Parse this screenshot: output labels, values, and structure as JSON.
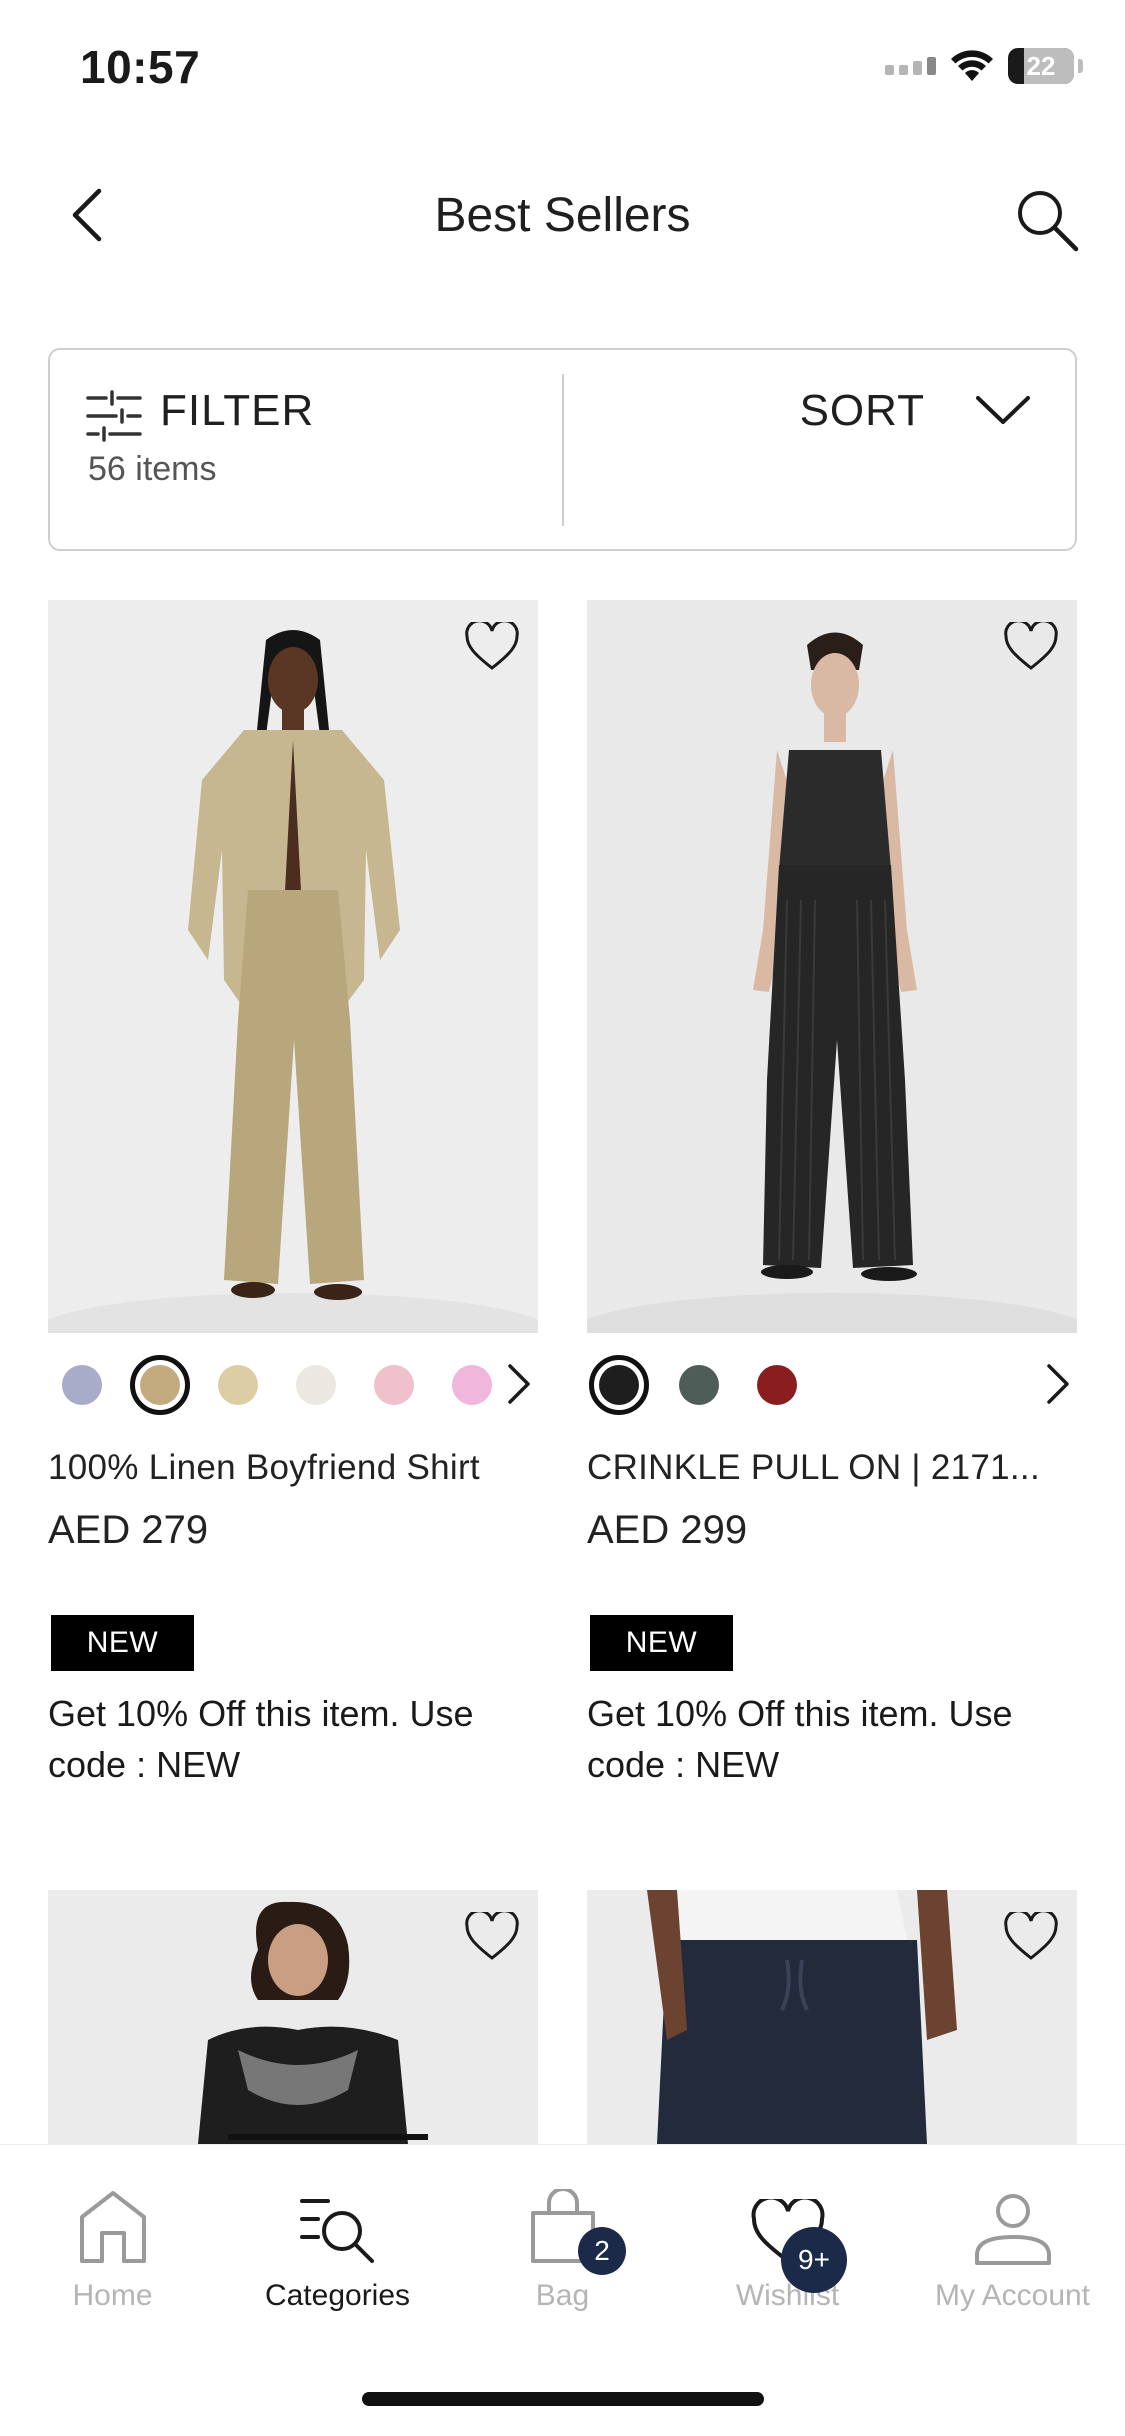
{
  "status_bar": {
    "time": "10:57",
    "battery": "22"
  },
  "header": {
    "title": "Best Sellers"
  },
  "filter_bar": {
    "filter_label": "FILTER",
    "item_count": "56 items",
    "sort_label": "SORT"
  },
  "products": [
    {
      "name": "100% Linen Boyfriend Shirt",
      "price": "AED 279",
      "badge": "NEW",
      "promo": "Get 10% Off this item. Use code : NEW",
      "swatches": [
        "#a8acc8",
        "#c4ab7f",
        "#dccda4",
        "#ebe8e2",
        "#f0c0cc",
        "#f0b6dc"
      ]
    },
    {
      "name": "CRINKLE PULL ON | 2171...",
      "price": "AED 299",
      "badge": "NEW",
      "promo": "Get 10% Off this item. Use code : NEW",
      "swatches": [
        "#1e1e1e",
        "#4f5d58",
        "#8a1e1e"
      ]
    }
  ],
  "tab_bar": {
    "tabs": [
      {
        "label": "Home",
        "icon": "home-icon"
      },
      {
        "label": "Categories",
        "icon": "categories-search-icon"
      },
      {
        "label": "Bag",
        "icon": "bag-icon",
        "badge": "2"
      },
      {
        "label": "Wishlist",
        "icon": "heart-icon",
        "badge": "9+"
      },
      {
        "label": "My Account",
        "icon": "person-icon"
      }
    ]
  },
  "colors": {
    "badge_bg": "#000000",
    "tab_badge_bg": "#1c2a4a",
    "inactive_tab": "#b5b5b5"
  }
}
